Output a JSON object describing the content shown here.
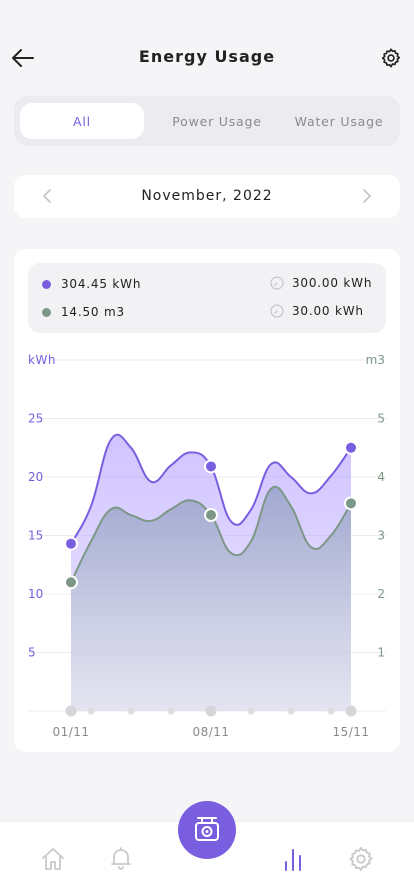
{
  "header": {
    "title": "Energy Usage"
  },
  "tabs": [
    {
      "label": "All",
      "active": true
    },
    {
      "label": "Power Usage",
      "active": false
    },
    {
      "label": "Water Usage",
      "active": false
    }
  ],
  "month_selector": {
    "label": "November, 2022"
  },
  "legend": {
    "power_value": "304.45 kWh",
    "water_value": "14.50 m3",
    "power_target": "300.00 kWh",
    "water_target": "30.00 kWh"
  },
  "colors": {
    "accent": "#7a5ee0",
    "power": "#7a5ee0",
    "water": "#7d9787"
  },
  "chart_data": {
    "type": "area",
    "left_axis": {
      "label": "kWh",
      "ticks": [
        "25",
        "20",
        "15",
        "10",
        "5"
      ],
      "range": [
        0,
        30
      ]
    },
    "right_axis": {
      "label": "m3",
      "ticks": [
        "5",
        "4",
        "3",
        "2",
        "1"
      ],
      "range": [
        0,
        6
      ]
    },
    "x_ticks": [
      "01/11",
      "08/11",
      "15/11"
    ],
    "series": [
      {
        "axis": "left",
        "x": [
          1,
          2,
          3,
          4,
          5,
          6,
          7,
          8,
          9,
          10,
          11,
          12,
          13,
          14,
          15
        ],
        "values": [
          14.3,
          17.5,
          23.2,
          22.5,
          19.6,
          21.0,
          22.1,
          20.9,
          16.2,
          17.2,
          21.1,
          20.0,
          18.6,
          20.1,
          22.5
        ]
      },
      {
        "axis": "right",
        "x": [
          1,
          2,
          3,
          4,
          5,
          6,
          7,
          8,
          9,
          10,
          11,
          12,
          13,
          14,
          15
        ],
        "values": [
          2.2,
          2.9,
          3.45,
          3.35,
          3.25,
          3.45,
          3.6,
          3.35,
          2.7,
          2.9,
          3.8,
          3.5,
          2.8,
          3.0,
          3.55
        ]
      }
    ],
    "markers": [
      {
        "series": 0,
        "x": 1
      },
      {
        "series": 0,
        "x": 8
      },
      {
        "series": 0,
        "x": 15
      },
      {
        "series": 1,
        "x": 1
      },
      {
        "series": 1,
        "x": 8
      },
      {
        "series": 1,
        "x": 15
      }
    ]
  },
  "nav": {
    "items": [
      "home-icon",
      "bell-icon",
      "camera-icon",
      "bar-chart-icon",
      "settings-icon"
    ],
    "active": "bar-chart-icon"
  }
}
